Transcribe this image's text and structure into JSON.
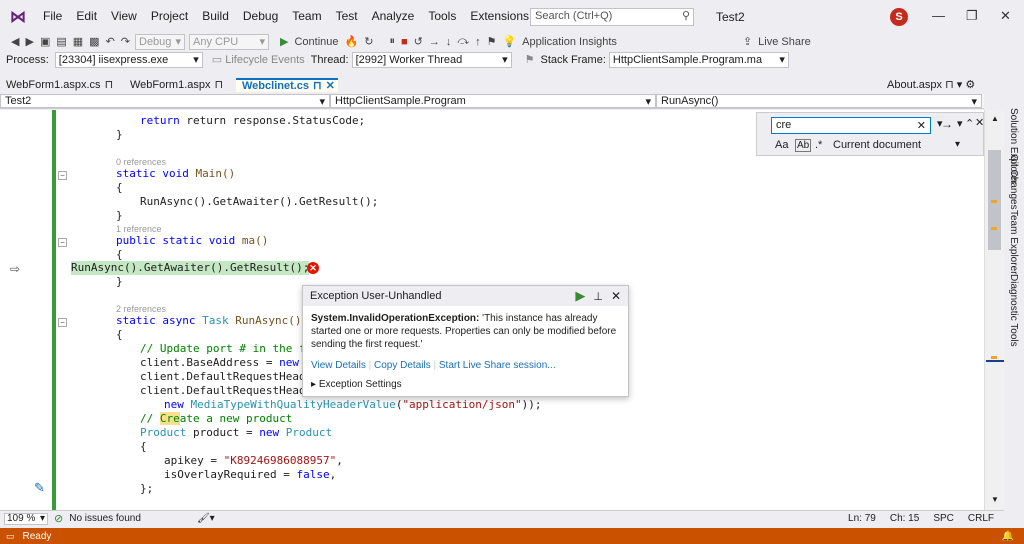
{
  "menu": [
    "File",
    "Edit",
    "View",
    "Project",
    "Build",
    "Debug",
    "Team",
    "Test",
    "Analyze",
    "Tools",
    "Extensions",
    "Window",
    "Help"
  ],
  "search": {
    "placeholder": "Search (Ctrl+Q)"
  },
  "solution_name": "Test2",
  "avatar_initial": "S",
  "toolbar": {
    "config": "Debug",
    "platform": "Any CPU",
    "continue_label": "Continue",
    "app_insights": "Application Insights",
    "live_share": "Live Share"
  },
  "debugbar": {
    "process_label": "Process:",
    "process_value": "[23304] iisexpress.exe",
    "lifecycle": "Lifecycle Events",
    "thread_label": "Thread:",
    "thread_value": "[2992] Worker Thread",
    "stack_label": "Stack Frame:",
    "stack_value": "HttpClientSample.Program.ma"
  },
  "tabs": [
    "WebForm1.aspx.cs",
    "WebForm1.aspx",
    "Webclinet.cs"
  ],
  "tab_right": "About.aspx",
  "nav": {
    "project": "Test2",
    "class": "HttpClientSample.Program",
    "member": "RunAsync()"
  },
  "find": {
    "value": "cre",
    "scope": "Current document",
    "opt_case": "Aa",
    "opt_word": "Ab"
  },
  "code": {
    "l0": "return response.StatusCode;",
    "l1": "}",
    "r1": "0 references",
    "l2a": "static",
    "l2b": "void",
    "l2c": "Main()",
    "l3": "{",
    "l4": "RunAsync().GetAwaiter().GetResult();",
    "l5": "}",
    "r2": "1 reference",
    "l6a": "public",
    "l6b": "static",
    "l6c": "void",
    "l6d": "ma()",
    "l7": "{",
    "l8": "RunAsync().GetAwaiter().GetResult();",
    "l9": "}",
    "r3": "2 references",
    "l10a": "static",
    "l10b": "async",
    "l10c": "Task",
    "l10d": "RunAsync()",
    "l11": "{",
    "l12": "// Update port # in the fo",
    "l13a": "client.BaseAddress = ",
    "l13b": "new",
    "l13c": "U",
    "l14": "client.DefaultRequestHeade",
    "l15": "client.DefaultRequestHeade",
    "l16a": "new",
    "l16b": "MediaTypeWithQualityHeaderValue",
    "l16c": "(",
    "l16d": "\"application/json\"",
    "l16e": "));",
    "l17a": "// ",
    "l17b": "Cre",
    "l17c": "ate a new product",
    "l18a": "Product",
    "l18b": " product = ",
    "l18c": "new",
    "l18d": "Product",
    "l19": "{",
    "l20a": "apikey = ",
    "l20b": "\"K89246986088957\"",
    "l20c": ",",
    "l21a": "isOverlayRequired = ",
    "l21b": "false",
    "l21c": ",",
    "l22": "};"
  },
  "exception": {
    "title": "Exception User-Unhandled",
    "type": "System.InvalidOperationException:",
    "message": "'This instance has already started one or more requests. Properties can only be modified before sending the first request.'",
    "view_details": "View Details",
    "copy_details": "Copy Details",
    "live_share": "Start Live Share session...",
    "settings": "Exception Settings"
  },
  "side_panels": [
    "Solution Explorer",
    "Git Changes",
    "Team Explorer",
    "Diagnostic Tools"
  ],
  "status": {
    "zoom": "109 %",
    "issues": "No issues found",
    "ln": "Ln: 79",
    "ch": "Ch: 15",
    "spc": "SPC",
    "crlf": "CRLF",
    "ready": "Ready"
  }
}
